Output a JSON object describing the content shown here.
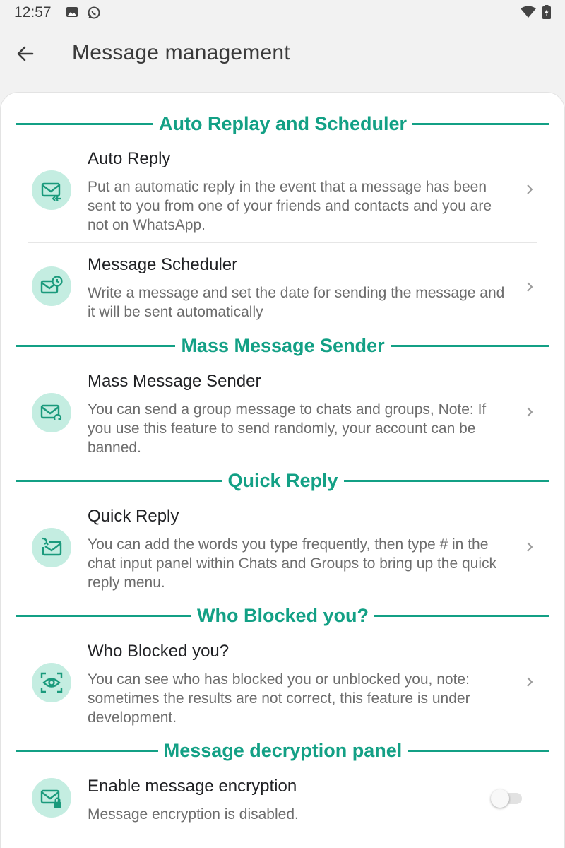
{
  "status_bar": {
    "time": "12:57",
    "icons": [
      "gallery-icon",
      "whatsapp-icon",
      "wifi-icon",
      "battery-icon"
    ]
  },
  "app_bar": {
    "title": "Message management",
    "back_icon": "back-arrow-icon"
  },
  "accent_color": "#13a085",
  "icon_bg_color": "#c4ede1",
  "sections": [
    {
      "title": "Auto Replay and Scheduler",
      "items": [
        {
          "title": "Auto Reply",
          "description": "Put an automatic reply in the event that a message has been sent to you from one of your friends and contacts and you are not on WhatsApp.",
          "icon": "mail-reply-icon"
        },
        {
          "title": "Message Scheduler",
          "description": "Write a message and set the date for sending the message and it will be sent automatically",
          "icon": "mail-clock-icon"
        }
      ]
    },
    {
      "title": "Mass Message Sender",
      "items": [
        {
          "title": "Mass Message Sender",
          "description": "You can send a group message to chats and groups, Note: If you use this feature to send randomly, your account can be banned.",
          "icon": "mail-forward-icon"
        }
      ]
    },
    {
      "title": "Quick Reply",
      "items": [
        {
          "title": "Quick Reply",
          "description": "You can add the words you type frequently, then type # in the chat input panel within Chats and Groups to bring up the quick reply menu.",
          "icon": "mail-quick-reply-icon"
        }
      ]
    },
    {
      "title": "Who Blocked you?",
      "items": [
        {
          "title": "Who Blocked you?",
          "description": "You can see who has blocked you or unblocked you, note: sometimes the results are not correct, this feature is under development.",
          "icon": "eye-scan-icon"
        }
      ]
    },
    {
      "title": "Message decryption panel",
      "items": [
        {
          "title": "Enable message encryption",
          "description": "Message encryption is disabled.",
          "icon": "mail-lock-icon",
          "toggle_on": false
        }
      ]
    }
  ]
}
